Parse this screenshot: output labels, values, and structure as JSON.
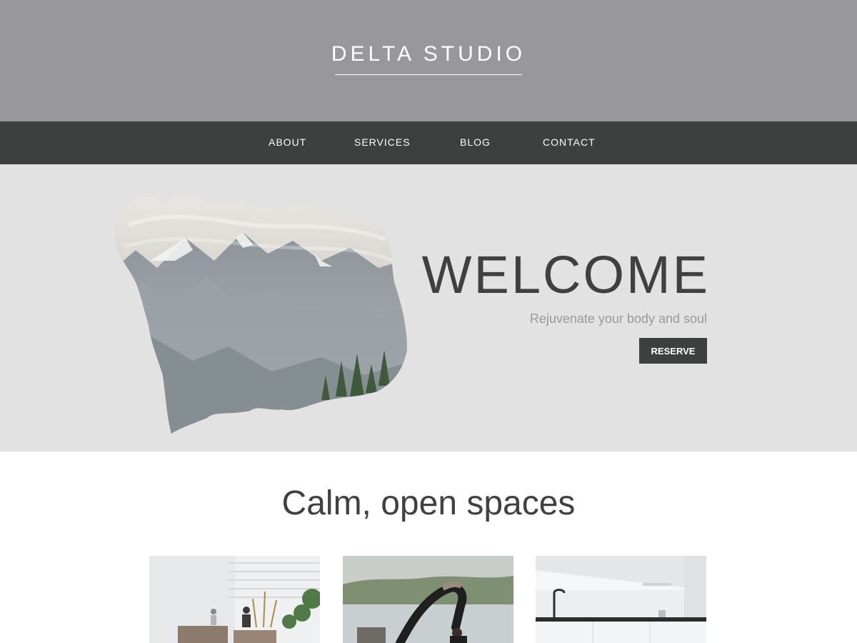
{
  "header": {
    "brand": "DELTA STUDIO"
  },
  "nav": {
    "items": [
      {
        "label": "ABOUT"
      },
      {
        "label": "SERVICES"
      },
      {
        "label": "BLOG"
      },
      {
        "label": "CONTACT"
      }
    ]
  },
  "hero": {
    "title": "WELCOME",
    "subtitle": "Rejuvenate your body and soul",
    "button_label": "RESERVE",
    "image": "bear-silhouette-mountain-double-exposure"
  },
  "spaces": {
    "title": "Calm, open spaces",
    "photos": [
      {
        "name": "courtyard-seating-photo"
      },
      {
        "name": "yoga-backbend-photo"
      },
      {
        "name": "white-kitchen-photo"
      }
    ]
  },
  "colors": {
    "header_bg": "#98979c",
    "nav_bg": "#3e3f3f",
    "hero_bg": "#e2e2e2",
    "title_text": "#404040",
    "subtitle_text": "#9a9a9a",
    "button_bg": "#3e3f3f"
  }
}
